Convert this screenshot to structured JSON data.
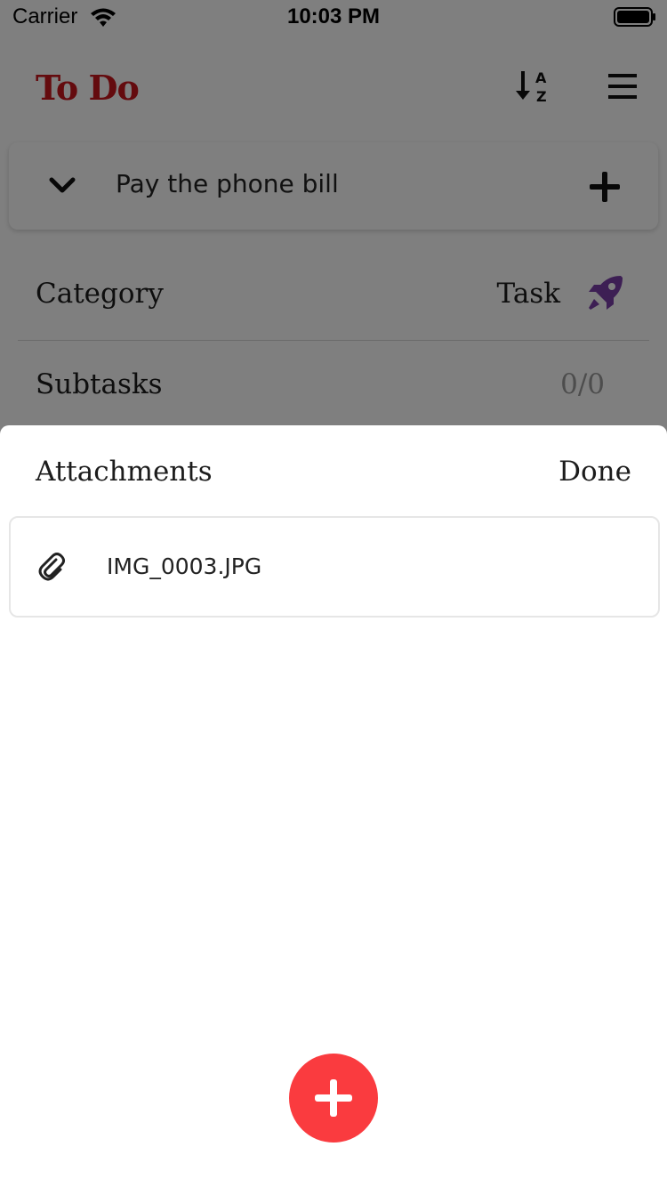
{
  "status_bar": {
    "carrier": "Carrier",
    "time": "10:03 PM"
  },
  "header": {
    "title": "To Do",
    "title_color": "#c8161d",
    "sort_icon": "sort-alpha-down-icon",
    "menu_icon": "hamburger-menu-icon"
  },
  "task": {
    "title": "Pay the phone bill",
    "expand_icon": "chevron-down-icon",
    "add_icon": "plus-icon"
  },
  "details": {
    "category_label": "Category",
    "category_value": "Task",
    "category_icon": "rocket-icon",
    "category_icon_color": "#7a3fa8",
    "subtasks_label": "Subtasks",
    "subtasks_value": "0/0"
  },
  "sheet": {
    "title": "Attachments",
    "done_label": "Done",
    "attachments": [
      {
        "name": "IMG_0003.JPG",
        "icon": "paperclip-icon"
      }
    ],
    "add_button_icon": "plus-icon",
    "add_button_color": "#fa3b3f"
  }
}
